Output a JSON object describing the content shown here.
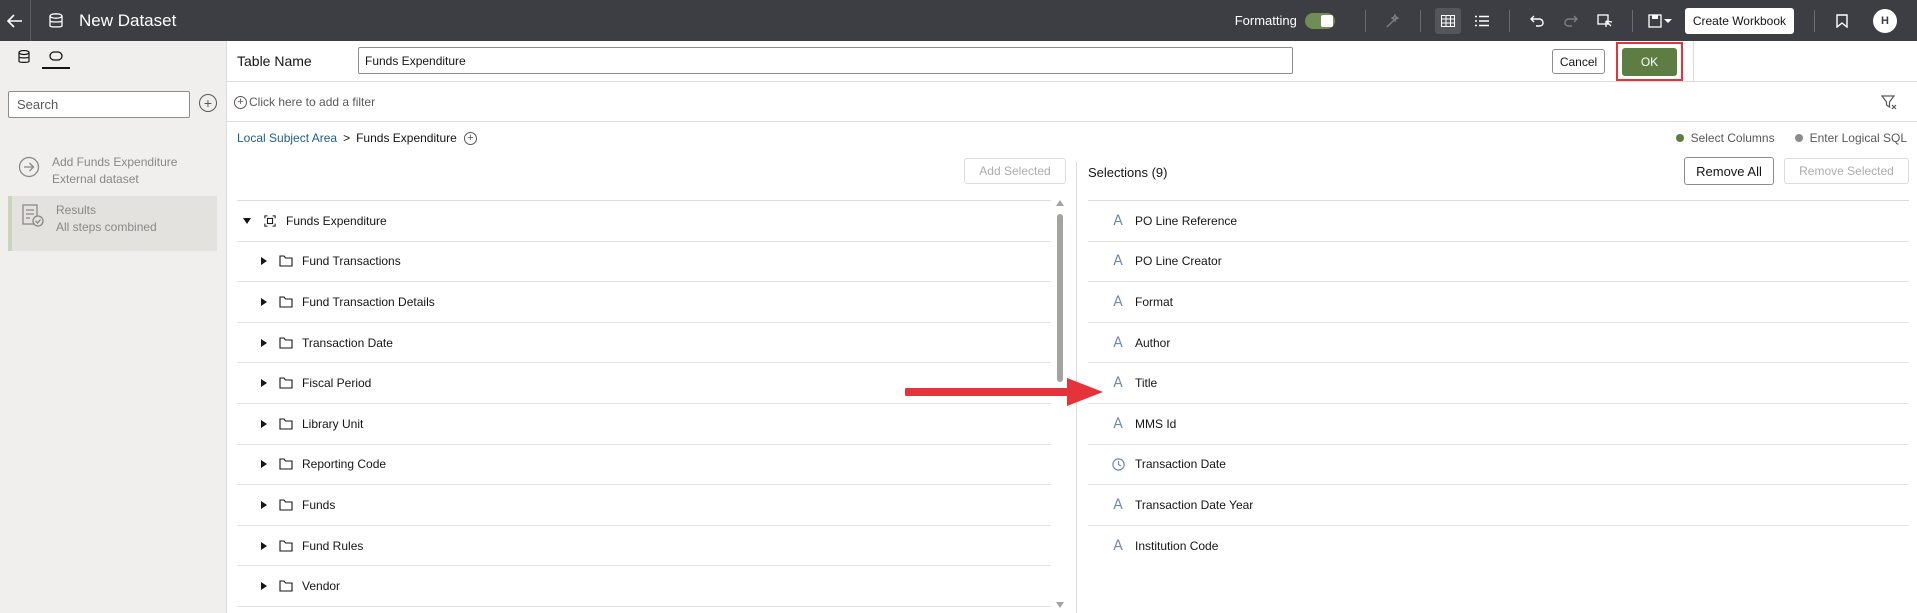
{
  "header": {
    "title": "New Dataset",
    "formatting_label": "Formatting",
    "create_workbook_label": "Create Workbook",
    "avatar_initial": "H"
  },
  "left_panel": {
    "search_placeholder": "Search",
    "steps": [
      {
        "line1": "Add Funds Expenditure",
        "line2": "External dataset"
      },
      {
        "line1": "Results",
        "line2": "All steps combined"
      }
    ]
  },
  "table_name": {
    "label": "Table Name",
    "value": "Funds Expenditure",
    "cancel_label": "Cancel",
    "ok_label": "OK"
  },
  "filter": {
    "placeholder": "Click here to add a filter"
  },
  "breadcrumb": {
    "root": "Local Subject Area",
    "separator": ">",
    "current": "Funds Expenditure"
  },
  "mode": {
    "select_columns": "Select Columns",
    "enter_logical_sql": "Enter Logical SQL",
    "selected_color": "#5d7d43",
    "unselected_color": "#8f8d8a"
  },
  "tree": {
    "add_selected_label": "Add Selected",
    "root": "Funds Expenditure",
    "folders": [
      "Fund Transactions",
      "Fund Transaction Details",
      "Transaction Date",
      "Fiscal Period",
      "Library Unit",
      "Reporting Code",
      "Funds",
      "Fund Rules",
      "Vendor"
    ]
  },
  "selections": {
    "title": "Selections (9)",
    "remove_all_label": "Remove All",
    "remove_selected_label": "Remove Selected",
    "items": [
      {
        "label": "PO Line Reference",
        "icon": "attribute-icon"
      },
      {
        "label": "PO Line Creator",
        "icon": "attribute-icon"
      },
      {
        "label": "Format",
        "icon": "attribute-icon"
      },
      {
        "label": "Author",
        "icon": "attribute-icon"
      },
      {
        "label": "Title",
        "icon": "attribute-icon"
      },
      {
        "label": "MMS Id",
        "icon": "attribute-icon"
      },
      {
        "label": "Transaction Date",
        "icon": "clock-icon"
      },
      {
        "label": "Transaction Date Year",
        "icon": "attribute-icon"
      },
      {
        "label": "Institution Code",
        "icon": "attribute-icon"
      }
    ]
  },
  "colors": {
    "topbar": "#3c3e44",
    "accent_green": "#5d7d43",
    "highlight_red": "#e4333b",
    "link_blue": "#1f5f8b"
  }
}
